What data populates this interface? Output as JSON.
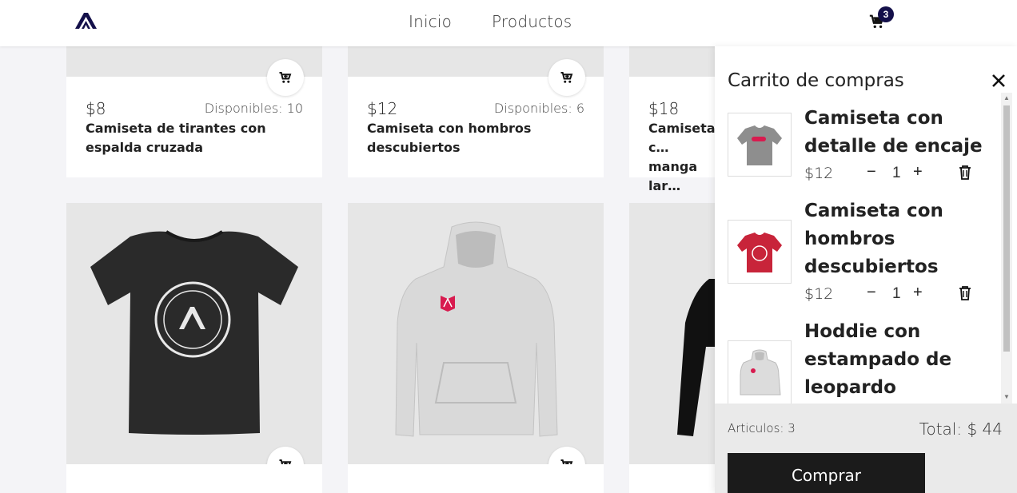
{
  "header": {
    "nav": [
      {
        "label": "Inicio"
      },
      {
        "label": "Productos"
      }
    ],
    "cart_count": "3"
  },
  "products": [
    {
      "price": "$8",
      "available": "Disponibles: 10",
      "name": "Camiseta de tirantes con espalda cruzada"
    },
    {
      "price": "$12",
      "available": "Disponibles: 6",
      "name": "Camiseta con hombros descubiertos"
    },
    {
      "price": "$18",
      "name": "Camiseta c… manga lar…"
    }
  ],
  "cart": {
    "title": "Carrito de compras",
    "items": [
      {
        "name": "Camiseta con detalle de encaje",
        "price": "$12",
        "qty": "1",
        "color": "#8e8e8e"
      },
      {
        "name": "Camiseta con hombros descubiertos",
        "price": "$12",
        "qty": "1",
        "color": "#c8243a"
      },
      {
        "name": "Hoddie con estampado de leopardo",
        "color": "#dcdcdc"
      }
    ],
    "count_label": "Articulos: 3",
    "total_label": "Total: $ 44",
    "buy_label": "Comprar",
    "minus": "−",
    "plus": "+"
  },
  "colors": {
    "brand": "#14104a",
    "accent": "#d81b4f"
  }
}
